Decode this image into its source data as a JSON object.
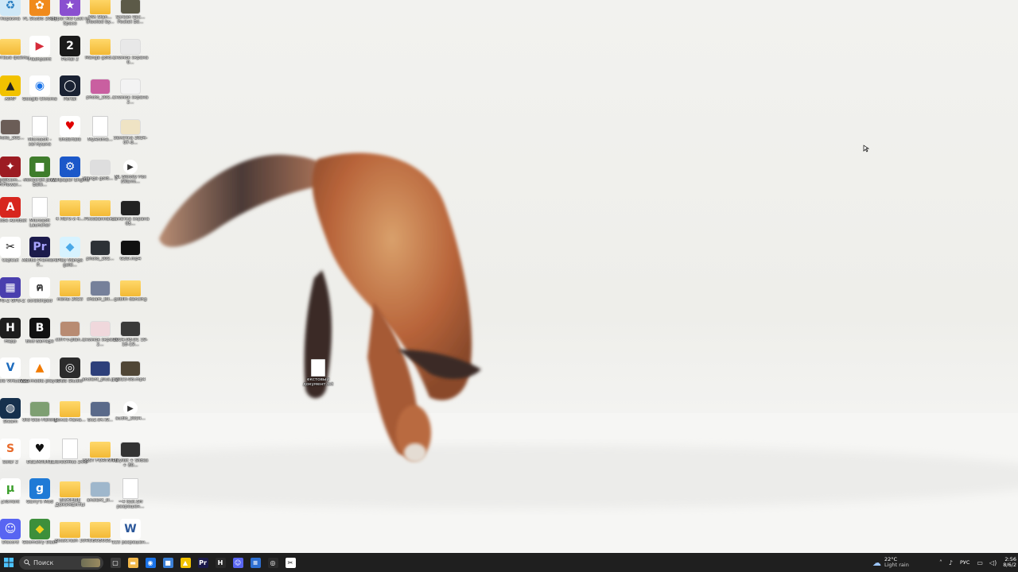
{
  "desktop": {
    "icons": [
      {
        "label": "Корзина",
        "kind": "recycle",
        "color": "#cfe8f7"
      },
      {
        "label": "FL Studio 2024",
        "kind": "app",
        "color": "#f08a1c",
        "glyph": "✿"
      },
      {
        "label": "Hyper Kid Lost in Space",
        "kind": "app",
        "color": "#8a4fd0",
        "glyph": "★"
      },
      {
        "label": "VIA Stan... (Rooted by...",
        "kind": "folder"
      },
      {
        "label": "Screen Rec... Pocket Ed...",
        "kind": "img",
        "color": "#5c5a48"
      },
      {
        "label": "мертвые файлы",
        "kind": "folder"
      },
      {
        "label": "Flashpoint",
        "kind": "app",
        "color": "#ffffff",
        "glyph": "▶",
        "fg": "#d62b3a"
      },
      {
        "label": "Portal 2",
        "kind": "app",
        "color": "#1a1a1a",
        "glyph": "2"
      },
      {
        "label": "Manga gold...",
        "kind": "folder"
      },
      {
        "label": "Снимок экрана 0...",
        "kind": "img",
        "color": "#e8e8e8"
      },
      {
        "label": "AIMP",
        "kind": "app",
        "color": "#f2c200",
        "glyph": "▲",
        "fg": "#222"
      },
      {
        "label": "Google Chrome",
        "kind": "app",
        "color": "#ffffff",
        "glyph": "◉",
        "fg": "#1a73e8"
      },
      {
        "label": "Portal",
        "kind": "app",
        "color": "#1a2233",
        "glyph": "◯"
      },
      {
        "label": "photo_202...",
        "kind": "img",
        "color": "#c95fa0"
      },
      {
        "label": "Снимок экрана 2...",
        "kind": "img",
        "color": "#f3f3f3"
      },
      {
        "label": "photo_202...",
        "kind": "img",
        "color": "#6b5d57"
      },
      {
        "label": "Microsoft - заглушка",
        "kind": "doc"
      },
      {
        "label": "Undertale",
        "kind": "app",
        "color": "#ffffff",
        "glyph": "♥",
        "fg": "#e00000"
      },
      {
        "label": "MyAnime...",
        "kind": "doc"
      },
      {
        "label": "Заметка 2024-07-0...",
        "kind": "img",
        "color": "#efe3c4"
      },
      {
        "label": "SpellCom... - FrFlower...",
        "kind": "app",
        "color": "#9c1b22",
        "glyph": "✦"
      },
      {
        "label": "Minecraft Java Editi...",
        "kind": "app",
        "color": "#3f7d2c",
        "glyph": "■"
      },
      {
        "label": "Wallpaper Engine",
        "kind": "app",
        "color": "#1b58c9",
        "glyph": "⚙"
      },
      {
        "label": "Manga gold... 2",
        "kind": "img",
        "color": "#dedede"
      },
      {
        "label": "NL Bloody Fox (Warm...",
        "kind": "media",
        "color": "#ffffff"
      },
      {
        "label": "Adobe Acrobat",
        "kind": "app",
        "color": "#d7261e",
        "glyph": "A"
      },
      {
        "label": "Microsoft Launcher",
        "kind": "doc"
      },
      {
        "label": "4 Лаги и 4...",
        "kind": "folder"
      },
      {
        "label": "Рисованная...",
        "kind": "folder"
      },
      {
        "label": "Заметка экрана 05...",
        "kind": "img",
        "color": "#222222"
      },
      {
        "label": "CapCut",
        "kind": "app",
        "color": "#ffffff",
        "glyph": "✂",
        "fg": "#111"
      },
      {
        "label": "Adobe Premiere P...",
        "kind": "app",
        "color": "#1c1b4b",
        "glyph": "Pr",
        "fg": "#a9a4ff"
      },
      {
        "label": "Play Manga gold...",
        "kind": "app",
        "color": "#d7f3ff",
        "glyph": "◆",
        "fg": "#4aa9e8"
      },
      {
        "label": "photo_202...",
        "kind": "img",
        "color": "#2d3136"
      },
      {
        "label": "G3D.mp4",
        "kind": "img",
        "color": "#111111"
      },
      {
        "label": "GPU-Z GPU-Z",
        "kind": "app",
        "color": "#4a3fae",
        "glyph": "▦"
      },
      {
        "label": "scratchpad",
        "kind": "app",
        "color": "#ffffff",
        "glyph": "ฅ",
        "fg": "#333"
      },
      {
        "label": "мемы 2023",
        "kind": "folder"
      },
      {
        "label": "shaam_bil...",
        "kind": "img",
        "color": "#76809a"
      },
      {
        "label": "goblin dancing",
        "kind": "folder"
      },
      {
        "label": "Happ",
        "kind": "app",
        "color": "#1e1e1e",
        "glyph": "H"
      },
      {
        "label": "Bud Barrage",
        "kind": "app",
        "color": "#111111",
        "glyph": "B"
      },
      {
        "label": "ctrl+v-plan...",
        "kind": "img",
        "color": "#b88b72"
      },
      {
        "label": "Снимок экрана 2...",
        "kind": "img",
        "color": "#f0d8dc"
      },
      {
        "label": "2024-08-01 19-18-19...",
        "kind": "img",
        "color": "#3a3a3a"
      },
      {
        "label": "Oracle VirtualBox",
        "kind": "app",
        "color": "#ffffff",
        "glyph": "V",
        "fg": "#1c6bbd"
      },
      {
        "label": "VLC media player",
        "kind": "app",
        "color": "#ffffff",
        "glyph": "▲",
        "fg": "#f27a00"
      },
      {
        "label": "OBS Studio",
        "kind": "app",
        "color": "#2b2b2b",
        "glyph": "◎"
      },
      {
        "label": "ancient_plus.jpg",
        "kind": "img",
        "color": "#2d3f7a"
      },
      {
        "label": "2023-08.mp4",
        "kind": "img",
        "color": "#504636"
      },
      {
        "label": "Steam",
        "kind": "app",
        "color": "#16304d",
        "glyph": "◍"
      },
      {
        "label": "Old Geo Fishing",
        "kind": "img",
        "color": "#7e9f72"
      },
      {
        "label": "Бокса Кама...",
        "kind": "folder"
      },
      {
        "label": "Бо2.04.W...",
        "kind": "img",
        "color": "#5a6a8a"
      },
      {
        "label": "audio_2024...",
        "kind": "media",
        "color": "#ffffff"
      },
      {
        "label": "Solar 2",
        "kind": "app",
        "color": "#ffffff",
        "glyph": "S",
        "fg": "#e86a2a"
      },
      {
        "label": "DELTARUNE",
        "kind": "app",
        "color": "#ffffff",
        "glyph": "♥",
        "fg": "#111"
      },
      {
        "label": "LibreOffice 24.8",
        "kind": "doc"
      },
      {
        "label": "BEST FORTNITE",
        "kind": "folder"
      },
      {
        "label": "Playlist + Slides + 80...",
        "kind": "img",
        "color": "#333333"
      },
      {
        "label": "µTorrent",
        "kind": "app",
        "color": "#ffffff",
        "glyph": "µ",
        "fg": "#3a9e2a"
      },
      {
        "label": "Garry's Mod",
        "kind": "app",
        "color": "#1f7ad6",
        "glyph": "g"
      },
      {
        "label": "ВАЖНЫЕ ДОКУМЕНТЫ",
        "kind": "folder"
      },
      {
        "label": "ancient_sl...",
        "kind": "img",
        "color": "#9fb7cc"
      },
      {
        "label": "~4 test.SH разрешен...",
        "kind": "doc"
      },
      {
        "label": "Discord",
        "kind": "app",
        "color": "#5865f2",
        "glyph": "☺"
      },
      {
        "label": "Geometry Dash",
        "kind": "app",
        "color": "#3d8f3b",
        "glyph": "◆",
        "fg": "#f2d21c"
      },
      {
        "label": "BossCrash 10",
        "kind": "folder"
      },
      {
        "label": "ROBOBUSS...",
        "kind": "folder"
      },
      {
        "label": "123 разрешен...",
        "kind": "app",
        "color": "#ffffff",
        "glyph": "W",
        "fg": "#2b579a"
      }
    ],
    "loose_file": {
      "label": "екстовый документ.txt"
    }
  },
  "taskbar": {
    "search_placeholder": "Поиск",
    "pinned": [
      {
        "name": "task-view",
        "glyph": "▢",
        "color": "#3b3b3b"
      },
      {
        "name": "file-explorer",
        "glyph": "▬",
        "color": "#f2b84a"
      },
      {
        "name": "chrome",
        "glyph": "◉",
        "color": "#1a73e8"
      },
      {
        "name": "store",
        "glyph": "■",
        "color": "#3a7fd6"
      },
      {
        "name": "aimp",
        "glyph": "▲",
        "color": "#f2c200"
      },
      {
        "name": "premiere",
        "glyph": "Pr",
        "color": "#1c1b4b"
      },
      {
        "name": "happ",
        "glyph": "H",
        "color": "#2a2a2a"
      },
      {
        "name": "discord",
        "glyph": "☺",
        "color": "#5865f2"
      },
      {
        "name": "notepad",
        "glyph": "≡",
        "color": "#2e6fd1"
      },
      {
        "name": "obs",
        "glyph": "◎",
        "color": "#2b2b2b"
      },
      {
        "name": "capcut",
        "glyph": "✂",
        "color": "#ffffff"
      }
    ],
    "weather_temp": "22°C",
    "weather_desc": "Light rain",
    "language": "РУС",
    "time": "2:56",
    "date": "8/6/2"
  }
}
